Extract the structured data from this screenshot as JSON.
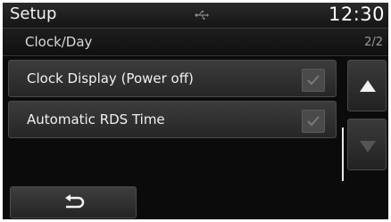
{
  "header": {
    "title": "Setup",
    "status_icon": "usb-icon",
    "clock": "12:30"
  },
  "subheader": {
    "title": "Clock/Day",
    "page_indicator": "2/2"
  },
  "settings": [
    {
      "label": "Clock Display (Power off)",
      "checked": true
    },
    {
      "label": "Automatic RDS Time",
      "checked": true
    }
  ],
  "scroll": {
    "up_icon": "triangle-up-icon",
    "down_icon": "triangle-down-icon",
    "down_enabled": false
  },
  "footer": {
    "back_icon": "back-arrow-icon"
  },
  "colors": {
    "background": "#0b0b0b",
    "text": "#f0f0f0",
    "disabled": "#555555"
  }
}
